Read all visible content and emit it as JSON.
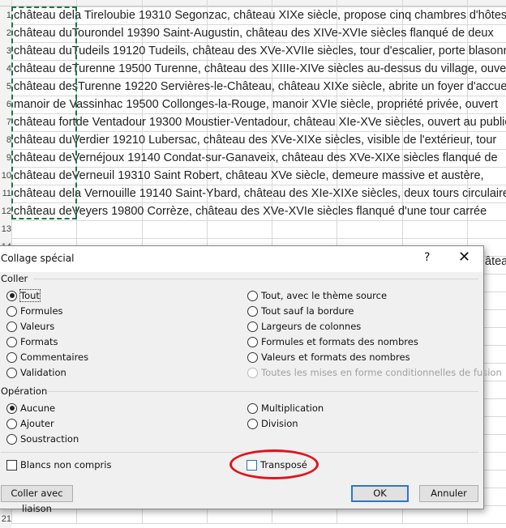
{
  "sheet": {
    "rows": [
      {
        "num": "1",
        "a": "château de",
        "rest": "la Tireloubie 19310 Segonzac, château XIXe siècle, propose cinq chambres d'hôtes"
      },
      {
        "num": "2",
        "a": "château du",
        "rest": "Tourondel 19390 Saint-Augustin, château des XIVe-XVIe siècles flanqué de deux"
      },
      {
        "num": "3",
        "a": "château du",
        "rest": "Tudeils 19120 Tudeils, château des XVe-XVIIe siècles, tour d'escalier, porte blasonnée"
      },
      {
        "num": "4",
        "a": "château de",
        "rest": "Turenne 19500 Turenne, château des XIIIe-XIVe siècles au-dessus du village, ouvert"
      },
      {
        "num": "5",
        "a": "château des",
        "rest": "Turenne 19220 Servières-le-Château, château XIXe siècle, abrite un foyer d'accueil"
      },
      {
        "num": "6",
        "a": "manoir de V",
        "rest": "assinhac 19500 Collonges-la-Rouge, manoir XVIe siècle, propriété privée, ouvert"
      },
      {
        "num": "7",
        "a": "château fort",
        "rest": "de Ventadour 19300 Moustier-Ventadour, château XIe-XVe siècles, ouvert au public"
      },
      {
        "num": "8",
        "a": "château du",
        "rest": "Verdier 19210 Lubersac, château des XVe-XIXe siècles, visible de l'extérieur, tour"
      },
      {
        "num": "9",
        "a": "château de",
        "rest": "Vernéjoux 19140 Condat-sur-Ganaveix, château des XVe-XIXe siècles flanqué de"
      },
      {
        "num": "10",
        "a": "château de",
        "rest": "Verneuil 19310 Saint Robert, château XVe siècle, demeure massive et austère,"
      },
      {
        "num": "11",
        "a": "château de",
        "rest": "la Vernouille 19140 Saint-Ybard, château des XIe-XIXe siècles, deux tours circulaires"
      },
      {
        "num": "12",
        "a": "château de",
        "rest": "Veyers 19800 Corrèze, château des XVe-XVIe siècles flanqué d'une tour carrée"
      },
      {
        "num": "13",
        "a": "",
        "rest": ""
      },
      {
        "num": "14",
        "a": "",
        "rest": ""
      }
    ],
    "behind_dialog_text": "âteau",
    "bottom_row": "21"
  },
  "dialog": {
    "title": "Collage spécial",
    "help": "?",
    "close": "✕",
    "paste_group": "Coller",
    "paste_left": [
      {
        "label": "Tout",
        "checked": true
      },
      {
        "label": "Formules"
      },
      {
        "label": "Valeurs"
      },
      {
        "label": "Formats"
      },
      {
        "label": "Commentaires"
      },
      {
        "label": "Validation"
      }
    ],
    "paste_right": [
      {
        "label": "Tout, avec le thème source"
      },
      {
        "label": "Tout sauf la bordure"
      },
      {
        "label": "Largeurs de colonnes"
      },
      {
        "label": "Formules et formats des nombres"
      },
      {
        "label": "Valeurs et formats des nombres"
      },
      {
        "label": "Toutes les mises en forme conditionnelles de fusion",
        "disabled": true
      }
    ],
    "operation_group": "Opération",
    "op_left": [
      {
        "label": "Aucune",
        "checked": true
      },
      {
        "label": "Ajouter"
      },
      {
        "label": "Soustraction"
      }
    ],
    "op_right": [
      {
        "label": "Multiplication"
      },
      {
        "label": "Division"
      }
    ],
    "skip_blanks": "Blancs non compris",
    "transpose": "Transposé",
    "paste_link": "Coller avec liaison",
    "ok": "OK",
    "cancel": "Annuler"
  },
  "colors": {
    "marquee": "#217346",
    "highlight_ellipse": "#e0141e",
    "default_button": "#2b78c4"
  }
}
